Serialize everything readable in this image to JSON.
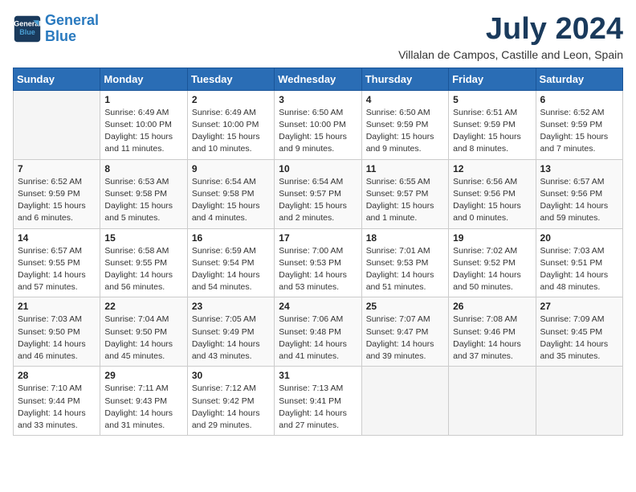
{
  "header": {
    "logo_line1": "General",
    "logo_line2": "Blue",
    "month_year": "July 2024",
    "location": "Villalan de Campos, Castille and Leon, Spain"
  },
  "weekdays": [
    "Sunday",
    "Monday",
    "Tuesday",
    "Wednesday",
    "Thursday",
    "Friday",
    "Saturday"
  ],
  "weeks": [
    [
      {
        "day": "",
        "info": ""
      },
      {
        "day": "1",
        "info": "Sunrise: 6:49 AM\nSunset: 10:00 PM\nDaylight: 15 hours\nand 11 minutes."
      },
      {
        "day": "2",
        "info": "Sunrise: 6:49 AM\nSunset: 10:00 PM\nDaylight: 15 hours\nand 10 minutes."
      },
      {
        "day": "3",
        "info": "Sunrise: 6:50 AM\nSunset: 10:00 PM\nDaylight: 15 hours\nand 9 minutes."
      },
      {
        "day": "4",
        "info": "Sunrise: 6:50 AM\nSunset: 9:59 PM\nDaylight: 15 hours\nand 9 minutes."
      },
      {
        "day": "5",
        "info": "Sunrise: 6:51 AM\nSunset: 9:59 PM\nDaylight: 15 hours\nand 8 minutes."
      },
      {
        "day": "6",
        "info": "Sunrise: 6:52 AM\nSunset: 9:59 PM\nDaylight: 15 hours\nand 7 minutes."
      }
    ],
    [
      {
        "day": "7",
        "info": "Sunrise: 6:52 AM\nSunset: 9:59 PM\nDaylight: 15 hours\nand 6 minutes."
      },
      {
        "day": "8",
        "info": "Sunrise: 6:53 AM\nSunset: 9:58 PM\nDaylight: 15 hours\nand 5 minutes."
      },
      {
        "day": "9",
        "info": "Sunrise: 6:54 AM\nSunset: 9:58 PM\nDaylight: 15 hours\nand 4 minutes."
      },
      {
        "day": "10",
        "info": "Sunrise: 6:54 AM\nSunset: 9:57 PM\nDaylight: 15 hours\nand 2 minutes."
      },
      {
        "day": "11",
        "info": "Sunrise: 6:55 AM\nSunset: 9:57 PM\nDaylight: 15 hours\nand 1 minute."
      },
      {
        "day": "12",
        "info": "Sunrise: 6:56 AM\nSunset: 9:56 PM\nDaylight: 15 hours\nand 0 minutes."
      },
      {
        "day": "13",
        "info": "Sunrise: 6:57 AM\nSunset: 9:56 PM\nDaylight: 14 hours\nand 59 minutes."
      }
    ],
    [
      {
        "day": "14",
        "info": "Sunrise: 6:57 AM\nSunset: 9:55 PM\nDaylight: 14 hours\nand 57 minutes."
      },
      {
        "day": "15",
        "info": "Sunrise: 6:58 AM\nSunset: 9:55 PM\nDaylight: 14 hours\nand 56 minutes."
      },
      {
        "day": "16",
        "info": "Sunrise: 6:59 AM\nSunset: 9:54 PM\nDaylight: 14 hours\nand 54 minutes."
      },
      {
        "day": "17",
        "info": "Sunrise: 7:00 AM\nSunset: 9:53 PM\nDaylight: 14 hours\nand 53 minutes."
      },
      {
        "day": "18",
        "info": "Sunrise: 7:01 AM\nSunset: 9:53 PM\nDaylight: 14 hours\nand 51 minutes."
      },
      {
        "day": "19",
        "info": "Sunrise: 7:02 AM\nSunset: 9:52 PM\nDaylight: 14 hours\nand 50 minutes."
      },
      {
        "day": "20",
        "info": "Sunrise: 7:03 AM\nSunset: 9:51 PM\nDaylight: 14 hours\nand 48 minutes."
      }
    ],
    [
      {
        "day": "21",
        "info": "Sunrise: 7:03 AM\nSunset: 9:50 PM\nDaylight: 14 hours\nand 46 minutes."
      },
      {
        "day": "22",
        "info": "Sunrise: 7:04 AM\nSunset: 9:50 PM\nDaylight: 14 hours\nand 45 minutes."
      },
      {
        "day": "23",
        "info": "Sunrise: 7:05 AM\nSunset: 9:49 PM\nDaylight: 14 hours\nand 43 minutes."
      },
      {
        "day": "24",
        "info": "Sunrise: 7:06 AM\nSunset: 9:48 PM\nDaylight: 14 hours\nand 41 minutes."
      },
      {
        "day": "25",
        "info": "Sunrise: 7:07 AM\nSunset: 9:47 PM\nDaylight: 14 hours\nand 39 minutes."
      },
      {
        "day": "26",
        "info": "Sunrise: 7:08 AM\nSunset: 9:46 PM\nDaylight: 14 hours\nand 37 minutes."
      },
      {
        "day": "27",
        "info": "Sunrise: 7:09 AM\nSunset: 9:45 PM\nDaylight: 14 hours\nand 35 minutes."
      }
    ],
    [
      {
        "day": "28",
        "info": "Sunrise: 7:10 AM\nSunset: 9:44 PM\nDaylight: 14 hours\nand 33 minutes."
      },
      {
        "day": "29",
        "info": "Sunrise: 7:11 AM\nSunset: 9:43 PM\nDaylight: 14 hours\nand 31 minutes."
      },
      {
        "day": "30",
        "info": "Sunrise: 7:12 AM\nSunset: 9:42 PM\nDaylight: 14 hours\nand 29 minutes."
      },
      {
        "day": "31",
        "info": "Sunrise: 7:13 AM\nSunset: 9:41 PM\nDaylight: 14 hours\nand 27 minutes."
      },
      {
        "day": "",
        "info": ""
      },
      {
        "day": "",
        "info": ""
      },
      {
        "day": "",
        "info": ""
      }
    ]
  ]
}
